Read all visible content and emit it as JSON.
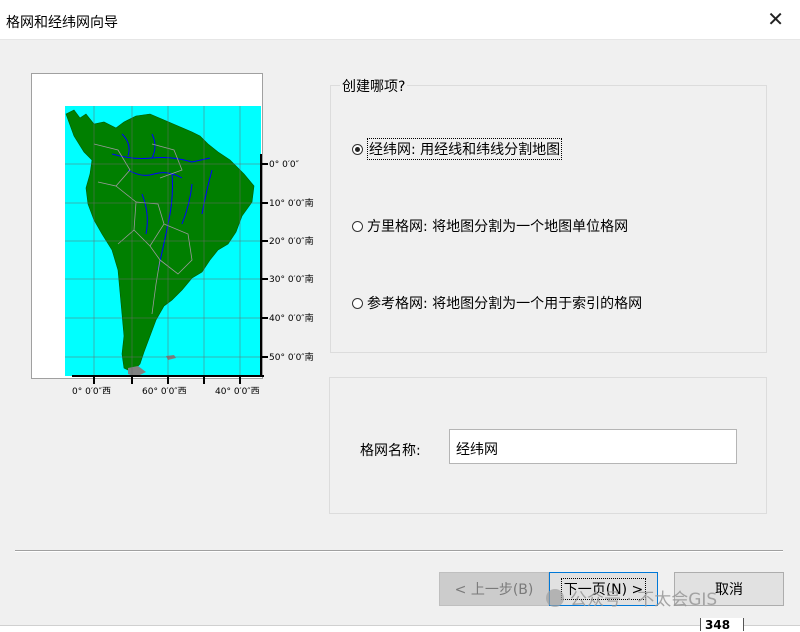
{
  "window": {
    "title": "格网和经纬网向导",
    "close_glyph": "✕"
  },
  "preview": {
    "lat_labels": [
      "0° 0′0″",
      "10° 0′0″南",
      "20° 0′0″南",
      "30° 0′0″南",
      "40° 0′0″南",
      "50° 0′0″南"
    ],
    "lon_labels": [
      "0° 0′0″西",
      "60° 0′0″西",
      "40° 0′0″西"
    ],
    "colors": {
      "ocean": "#00ffff",
      "land": "#007f00",
      "rivers": "#0000ff",
      "borders": "#9a9a9a"
    }
  },
  "create": {
    "legend": "创建哪项?",
    "options": [
      {
        "label": "经纬网: 用经线和纬线分割地图",
        "checked": true
      },
      {
        "label": "方里格网: 将地图分割为一个地图单位格网",
        "checked": false
      },
      {
        "label": "参考格网: 将地图分割为一个用于索引的格网",
        "checked": false
      }
    ]
  },
  "name_field": {
    "label": "格网名称:",
    "value": "经纬网"
  },
  "buttons": {
    "back": "< 上一步(B)",
    "next": "下一页(N) >",
    "cancel": "取消"
  },
  "watermark": "公众号 · 不太会GIS",
  "background": {
    "number": "348"
  }
}
